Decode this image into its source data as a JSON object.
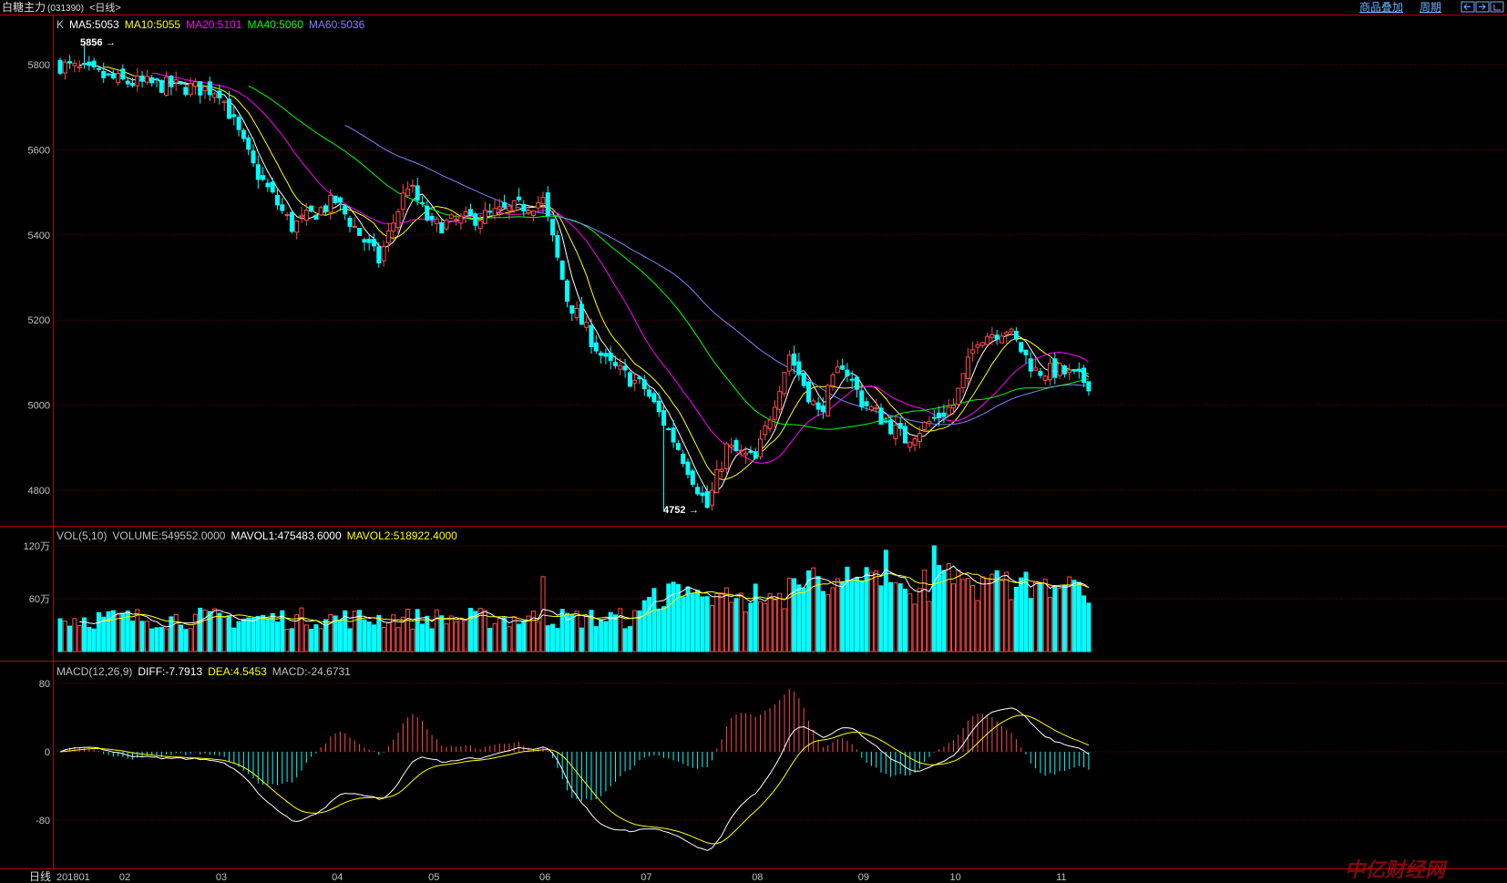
{
  "window": {
    "title": "白糖主力",
    "code": "(031390)",
    "period": "<日线>",
    "menu_overlay": "商品叠加",
    "menu_period": "周期"
  },
  "watermark": "中亿财经网",
  "colors": {
    "background": "#000000",
    "up": "#ff4a4a",
    "down": "#00ffff",
    "ma5": "#ffffff",
    "ma10": "#ffff00",
    "ma20": "#ff00ff",
    "ma40": "#00ff00",
    "ma60": "#8080ff",
    "grid": "#7a0000",
    "axis": "#b00000",
    "label": "#c0c0c0",
    "menu": "#6ab0ff"
  },
  "price_panel": {
    "legend": [
      {
        "text": "K",
        "color": "#c0c0c0"
      },
      {
        "text": "MA5:5053",
        "color": "#ffffff"
      },
      {
        "text": "MA10:5055",
        "color": "#ffff00"
      },
      {
        "text": "MA20:5101",
        "color": "#ff00ff"
      },
      {
        "text": "MA40:5060",
        "color": "#00ff00"
      },
      {
        "text": "MA60:5036",
        "color": "#8080ff"
      }
    ],
    "ticks": [
      "5800",
      "5600",
      "5400",
      "5200",
      "5000",
      "4800"
    ],
    "high_label": "5856",
    "low_label": "4752"
  },
  "volume_panel": {
    "legend": [
      {
        "text": "VOL(5,10)",
        "color": "#c0c0c0"
      },
      {
        "text": "VOLUME:549552.0000",
        "color": "#c0c0c0"
      },
      {
        "text": "MAVOL1:475483.6000",
        "color": "#ffffff"
      },
      {
        "text": "MAVOL2:518922.4000",
        "color": "#ffff00"
      }
    ],
    "ticks": [
      "120万",
      "60万"
    ]
  },
  "macd_panel": {
    "legend": [
      {
        "text": "MACD(12,26,9)",
        "color": "#c0c0c0"
      },
      {
        "text": "DIFF:-7.7913",
        "color": "#ffffff"
      },
      {
        "text": "DEA:4.5453",
        "color": "#ffff00"
      },
      {
        "text": "MACD:-24.6731",
        "color": "#c0c0c0"
      }
    ],
    "ticks": [
      "80",
      "0",
      "-80"
    ]
  },
  "x_axis": {
    "period_label": "日线",
    "labels": [
      "201801",
      "02",
      "03",
      "04",
      "05",
      "06",
      "07",
      "08",
      "09",
      "10",
      "11"
    ]
  },
  "chart_data": {
    "type": "candlestick",
    "instrument": "白糖主力",
    "period": "日线",
    "anchors": [
      {
        "month": "201801",
        "price": 5800
      },
      {
        "month": "02",
        "price": 5760
      },
      {
        "month": "03",
        "price": 5740
      },
      {
        "month": "04",
        "price": 5480
      },
      {
        "month": "05",
        "price": 5420
      },
      {
        "month": "06",
        "price": 5480
      },
      {
        "month": "07",
        "price": 5040
      },
      {
        "month": "08",
        "price": 4870
      },
      {
        "month": "09",
        "price": 5010
      },
      {
        "month": "10",
        "price": 5000
      },
      {
        "month": "11",
        "price": 5080
      }
    ],
    "extremes": {
      "high": 5856,
      "low": 4752
    },
    "price_axis": {
      "ylim": [
        4700,
        5900
      ],
      "ticks": [
        5800,
        5600,
        5400,
        5200,
        5000,
        4800
      ]
    },
    "moving_averages": {
      "MA5": 5053,
      "MA10": 5055,
      "MA20": 5101,
      "MA40": 5060,
      "MA60": 5036
    },
    "volume": {
      "VOLUME": 549552.0,
      "MAVOL1": 475483.6,
      "MAVOL2": 518922.4,
      "ticks": [
        "120万",
        "60万"
      ]
    },
    "macd": {
      "DIFF": -7.7913,
      "DEA": 4.5453,
      "MACD": -24.6731,
      "ticks": [
        80,
        0,
        -80
      ]
    }
  }
}
